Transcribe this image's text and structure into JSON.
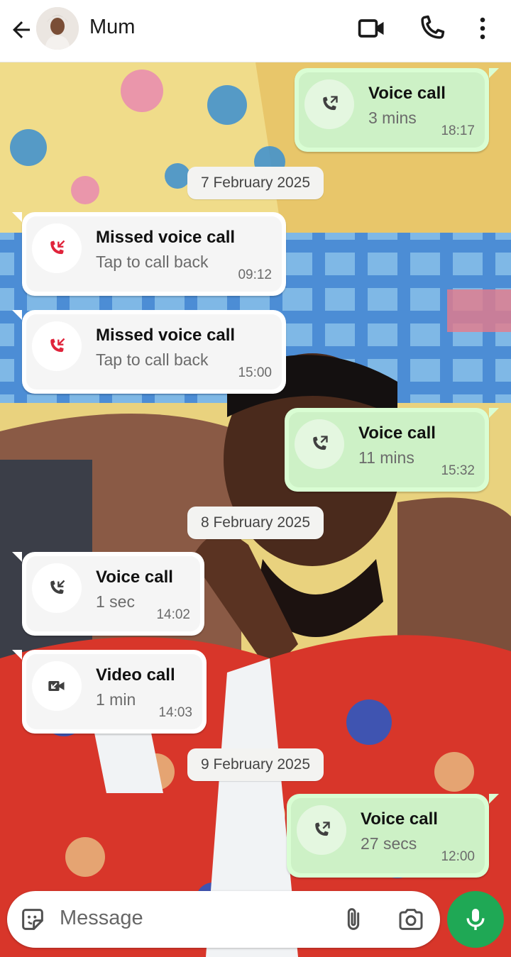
{
  "header": {
    "contact_name": "Mum",
    "icons": [
      "back-arrow-icon",
      "video-call-icon",
      "voice-call-icon",
      "more-options-icon"
    ]
  },
  "messages": [
    {
      "direction": "outgoing",
      "icon": "outgoing-call-icon",
      "title": "Voice call",
      "subtitle": "3 mins",
      "time": "18:17"
    },
    {
      "date_separator": "7 February 2025"
    },
    {
      "direction": "incoming",
      "icon": "missed-call-icon",
      "title": "Missed voice call",
      "subtitle": "Tap to call back",
      "time": "09:12"
    },
    {
      "direction": "incoming",
      "icon": "missed-call-icon",
      "title": "Missed voice call",
      "subtitle": "Tap to call back",
      "time": "15:00"
    },
    {
      "direction": "outgoing",
      "icon": "outgoing-call-icon",
      "title": "Voice call",
      "subtitle": "11 mins",
      "time": "15:32"
    },
    {
      "date_separator": "8 February 2025"
    },
    {
      "direction": "incoming",
      "icon": "incoming-call-icon",
      "title": "Voice call",
      "subtitle": "1 sec",
      "time": "14:02"
    },
    {
      "direction": "incoming",
      "icon": "video-call-icon",
      "title": "Video call",
      "subtitle": "1 min",
      "time": "14:03"
    },
    {
      "date_separator": "9 February 2025"
    },
    {
      "direction": "outgoing",
      "icon": "outgoing-call-icon",
      "title": "Voice call",
      "subtitle": "27 secs",
      "time": "12:00"
    }
  ],
  "composer": {
    "placeholder": "Message",
    "icons": [
      "sticker-icon",
      "attach-icon",
      "camera-icon",
      "mic-icon"
    ]
  },
  "colors": {
    "outgoing_bubble": "#d9fdd3",
    "incoming_bubble": "#ffffff",
    "missed_call": "#e0243b",
    "send_button": "#1fa855"
  }
}
